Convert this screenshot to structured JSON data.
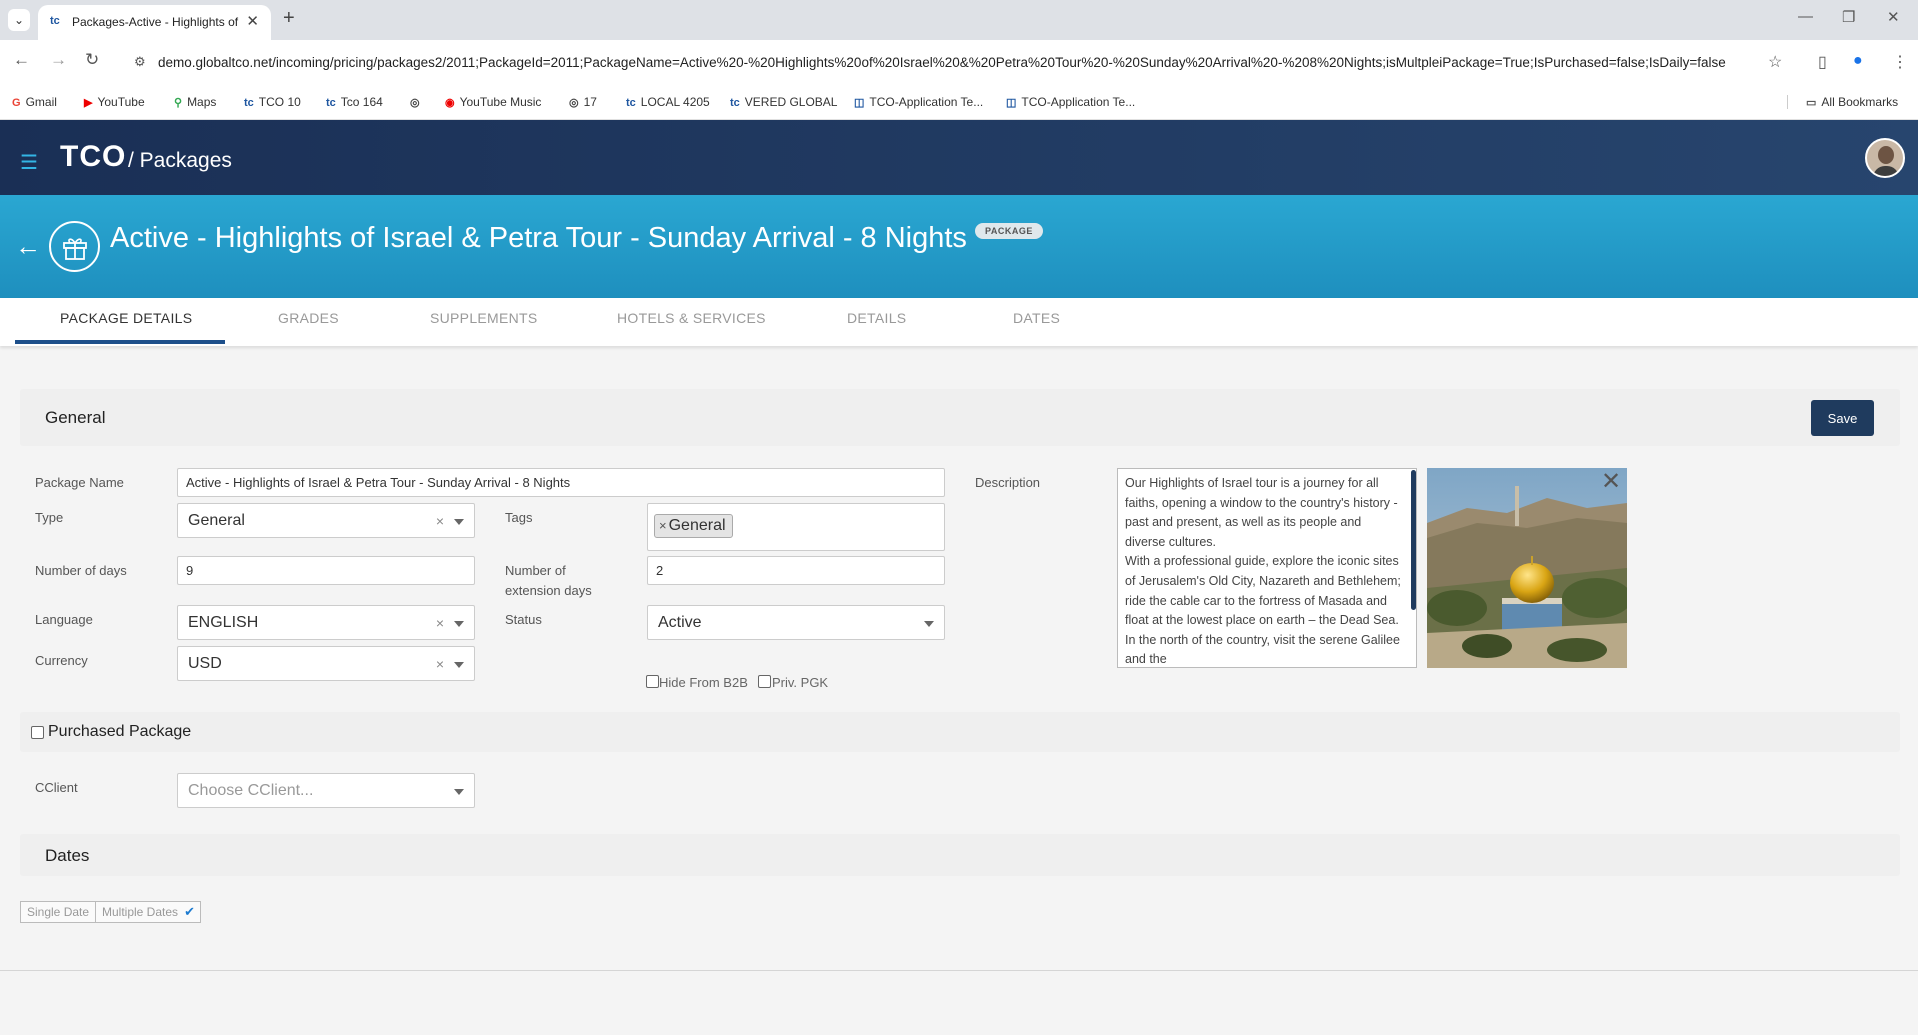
{
  "browser": {
    "tab_title": "Packages-Active - Highlights of Israel & Petra Tour",
    "url": "demo.globaltco.net/incoming/pricing/packages2/2011;PackageId=2011;PackageName=Active%20-%20Highlights%20of%20Israel%20&%20Petra%20Tour%20-%20Sunday%20Arrival%20-%208%20Nights;isMultpleiPackage=True;IsPurchased=false;IsDaily=false",
    "bookmarks": [
      "Gmail",
      "YouTube",
      "Maps",
      "TCO 10",
      "Tco 164",
      "",
      "YouTube Music",
      "17",
      "LOCAL 4205",
      "VERED GLOBAL",
      "TCO-Application Te...",
      "TCO-Application Te..."
    ],
    "all_bookmarks": "All Bookmarks"
  },
  "app": {
    "brand": "TCO",
    "section": "/ Packages"
  },
  "page": {
    "title": "Active - Highlights of Israel & Petra Tour - Sunday Arrival - 8 Nights",
    "badge": "PACKAGE"
  },
  "tabs": [
    "PACKAGE DETAILS",
    "GRADES",
    "SUPPLEMENTS",
    "HOTELS & SERVICES",
    "DETAILS",
    "DATES"
  ],
  "general": {
    "title": "General",
    "save_label": "Save",
    "package_name_label": "Package Name",
    "package_name": "Active - Highlights of Israel & Petra Tour - Sunday Arrival - 8 Nights",
    "type_label": "Type",
    "type_value": "General",
    "tags_label": "Tags",
    "tag_value": "General",
    "days_label": "Number of days",
    "days_value": "9",
    "ext_days_label_1": "Number of",
    "ext_days_label_2": "extension days",
    "ext_days_value": "2",
    "language_label": "Language",
    "language_value": "ENGLISH",
    "status_label": "Status",
    "status_value": "Active",
    "currency_label": "Currency",
    "currency_value": "USD",
    "hide_b2b_label": "Hide From B2B",
    "priv_pgk_label": "Priv. PGK",
    "description_label": "Description",
    "description": "Our Highlights of Israel tour is a journey for all faiths, opening a window to the country's history - past and present, as well as its people and diverse cultures.\nWith a professional guide, explore the iconic sites of Jerusalem's Old City, Nazareth and Bethlehem; ride the cable car to the fortress of Masada and float at the lowest place on earth – the Dead Sea. In the north of the country, visit the serene Galilee and the"
  },
  "purchased": {
    "title": "Purchased Package",
    "cclient_label": "CClient",
    "cclient_placeholder": "Choose CClient..."
  },
  "dates": {
    "title": "Dates",
    "single_label": "Single Date",
    "multiple_label": "Multiple Dates"
  }
}
